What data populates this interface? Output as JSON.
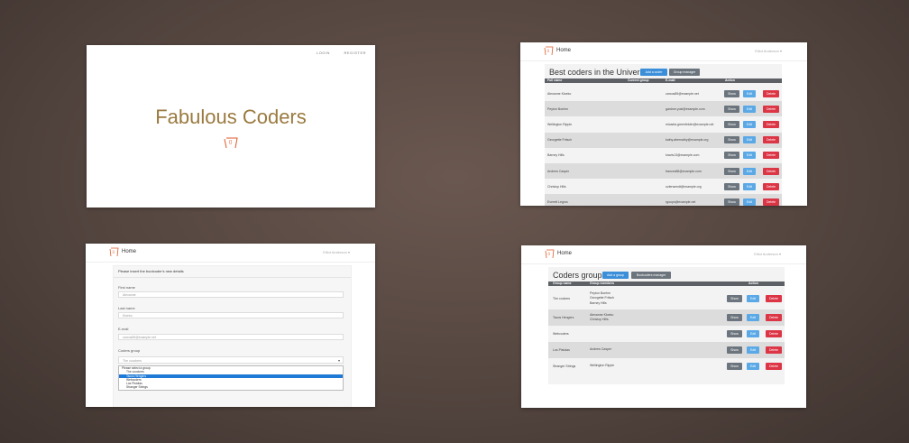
{
  "landing": {
    "nav_login": "LOGIN",
    "nav_register": "REGISTER",
    "title": "Fabulous Coders"
  },
  "coders": {
    "brand": "Home",
    "user": "Elliot Anderson ▾",
    "title": "Best coders in the Universe",
    "add_coder": "Add a coder",
    "group_manager": "Group manager",
    "headers": [
      "Full name",
      "Current group",
      "E-mail",
      "Action"
    ],
    "rows": [
      {
        "name": "Alexanne Kloeko",
        "group": "",
        "email": "carcos85@example.net"
      },
      {
        "name": "Peyton Boehm",
        "group": "",
        "email": "gardner.yost@example.com"
      },
      {
        "name": "Wellington Rippin",
        "group": "",
        "email": "micaela.greenfelder@example.net"
      },
      {
        "name": "Georgette Fritsch",
        "group": "",
        "email": "kathy.abernathy@example.org"
      },
      {
        "name": "Barney Hills",
        "group": "",
        "email": "kravis13@example.com"
      },
      {
        "name": "Andrew Casper",
        "group": "",
        "email": "frances86@example.com"
      },
      {
        "name": "Christop Hills",
        "group": "",
        "email": "ozlerwendt@example.org"
      },
      {
        "name": "Everett Legros",
        "group": "",
        "email": "rgoups@example.net"
      }
    ],
    "show": "Show",
    "edit": "Edit",
    "delete": "Delete"
  },
  "form": {
    "brand": "Home",
    "user": "Elliot Anderson ▾",
    "heading": "Please insert the bootcoder's new details",
    "first_name_label": "First name",
    "first_name_value": "Alexanne",
    "last_name_label": "Last name",
    "last_name_value": "Kloeko",
    "email_label": "E-mail",
    "email_value": "carcos85@example.net",
    "group_label": "Coders group",
    "group_value": "The coockers",
    "options": [
      {
        "label": "Please select a group",
        "indent": false,
        "selected": false
      },
      {
        "label": "The coockers",
        "indent": true,
        "selected": false
      },
      {
        "label": "Tacos Hengers",
        "indent": true,
        "selected": true
      },
      {
        "label": "Webcoders",
        "indent": true,
        "selected": false
      },
      {
        "label": "Los Pistolas",
        "indent": true,
        "selected": false
      },
      {
        "label": "Stranger Strings",
        "indent": true,
        "selected": false
      }
    ]
  },
  "groups": {
    "brand": "Home",
    "user": "Elliot Anderson ▾",
    "title": "Coders groups",
    "add_group": "Add a group",
    "coders_manager": "Bootcoders manager",
    "headers": [
      "Group name",
      "Group members",
      "Action"
    ],
    "rows": [
      {
        "name": "The cockers",
        "members": [
          "Peyton Boehm",
          "Georgette Fritsch",
          "Barney Hills"
        ]
      },
      {
        "name": "Tacos Hengers",
        "members": [
          "Alexanne Kloeko",
          "Christop Hills"
        ]
      },
      {
        "name": "Webcoders",
        "members": []
      },
      {
        "name": "Los Pistolas",
        "members": [
          "Andrew Casper"
        ]
      },
      {
        "name": "Stranger Strings",
        "members": [
          "Wellington Rippin"
        ]
      }
    ],
    "show": "Show",
    "edit": "Edit",
    "delete": "Delete"
  },
  "colors": {
    "brand_gold": "#9a7a3f",
    "primary": "#3b8fd9",
    "secondary": "#6c757d",
    "danger": "#dc3545"
  }
}
